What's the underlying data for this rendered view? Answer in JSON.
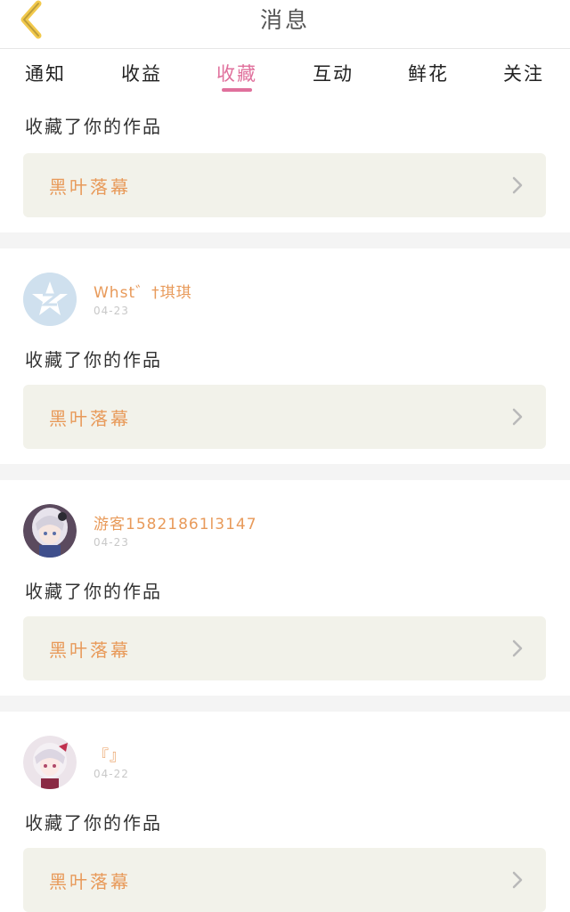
{
  "header": {
    "title": "消息",
    "back_icon": "chevron-left-icon",
    "accent": "#f2c94c"
  },
  "tabs": [
    {
      "label": "通知"
    },
    {
      "label": "收益"
    },
    {
      "label": "收藏",
      "active": true
    },
    {
      "label": "互动"
    },
    {
      "label": "鲜花"
    },
    {
      "label": "关注"
    }
  ],
  "accent_color": "#e0709c",
  "feed": [
    {
      "action": "收藏了你的作品",
      "work_title": "黑叶落幕"
    },
    {
      "user": "Whst゛†琪琪",
      "date": "04-23",
      "action": "收藏了你的作品",
      "work_title": "黑叶落幕",
      "avatar_icon": "qq-star-icon"
    },
    {
      "user": "游客15821861l3147",
      "date": "04-23",
      "action": "收藏了你的作品",
      "work_title": "黑叶落幕",
      "avatar_icon": "anime-girl-avatar"
    },
    {
      "user": "『』",
      "date": "04-22",
      "action": "收藏了你的作品",
      "work_title": "黑叶落幕",
      "avatar_icon": "anime-girl-avatar"
    }
  ]
}
